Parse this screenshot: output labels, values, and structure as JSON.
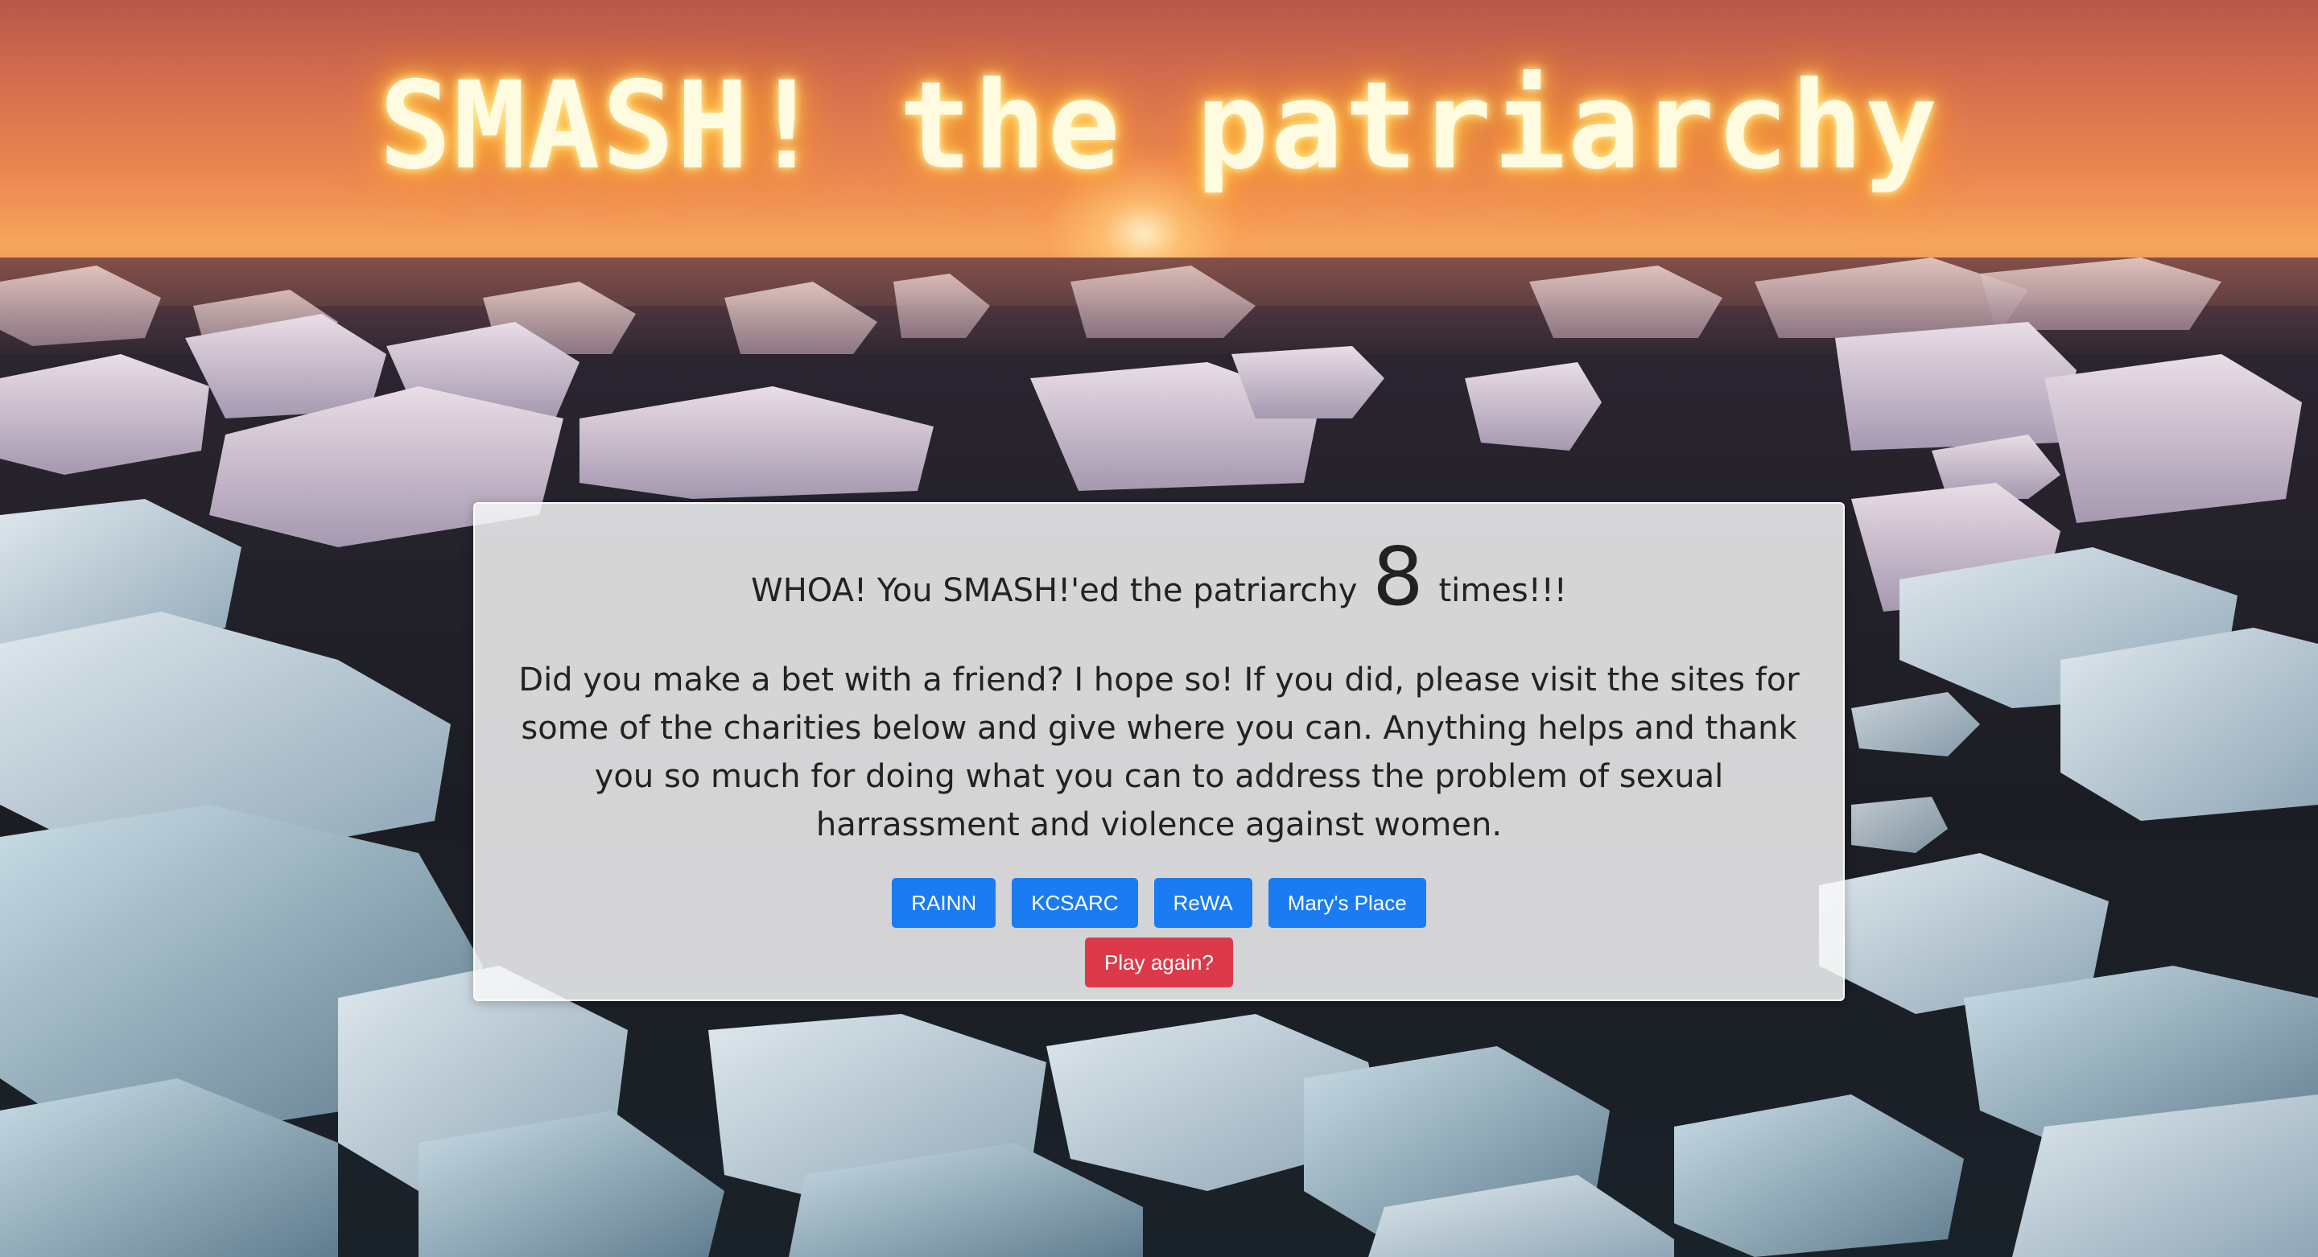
{
  "header": {
    "title": "SMASH! the patriarchy"
  },
  "result": {
    "prefix": "WHOA! You SMASH!'ed the patriarchy",
    "count": "8",
    "suffix": "times!!!",
    "message": "Did you make a bet with a friend? I hope so! If you did, please visit the sites for some of the charities below and give where you can. Anything helps and thank you so much for doing what you can to address the problem of sexual harrassment and violence against women."
  },
  "charities": [
    {
      "label": "RAINN"
    },
    {
      "label": "KCSARC"
    },
    {
      "label": "ReWA"
    },
    {
      "label": "Mary's Place"
    }
  ],
  "actions": {
    "play_again_label": "Play again?"
  },
  "colors": {
    "primary_button": "#1a7bf2",
    "danger_button": "#dc3a4a",
    "title_glow": "#ffb030"
  }
}
